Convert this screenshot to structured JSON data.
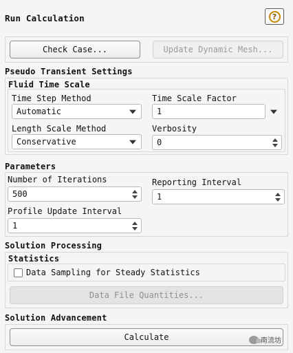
{
  "panel": {
    "title": "Run Calculation",
    "help_icon": "?"
  },
  "top_buttons": {
    "check_case": "Check Case...",
    "update_dynamic_mesh": "Update Dynamic Mesh..."
  },
  "pseudo": {
    "title": "Pseudo Transient Settings",
    "fluid_time_scale": "Fluid Time Scale",
    "time_step_method_label": "Time Step Method",
    "time_step_method_value": "Automatic",
    "time_scale_factor_label": "Time Scale Factor",
    "time_scale_factor_value": "1",
    "length_scale_method_label": "Length Scale Method",
    "length_scale_method_value": "Conservative",
    "verbosity_label": "Verbosity",
    "verbosity_value": "0"
  },
  "parameters": {
    "title": "Parameters",
    "num_iterations_label": "Number of Iterations",
    "num_iterations_value": "500",
    "reporting_interval_label": "Reporting Interval",
    "reporting_interval_value": "1",
    "profile_update_label": "Profile Update Interval",
    "profile_update_value": "1"
  },
  "solution_processing": {
    "title": "Solution Processing",
    "statistics": "Statistics",
    "data_sampling_label": "Data Sampling for Steady Statistics",
    "data_file_quantities": "Data File Quantities..."
  },
  "solution_advancement": {
    "title": "Solution Advancement",
    "calculate": "Calculate"
  },
  "watermark": {
    "text": "南流坊"
  }
}
